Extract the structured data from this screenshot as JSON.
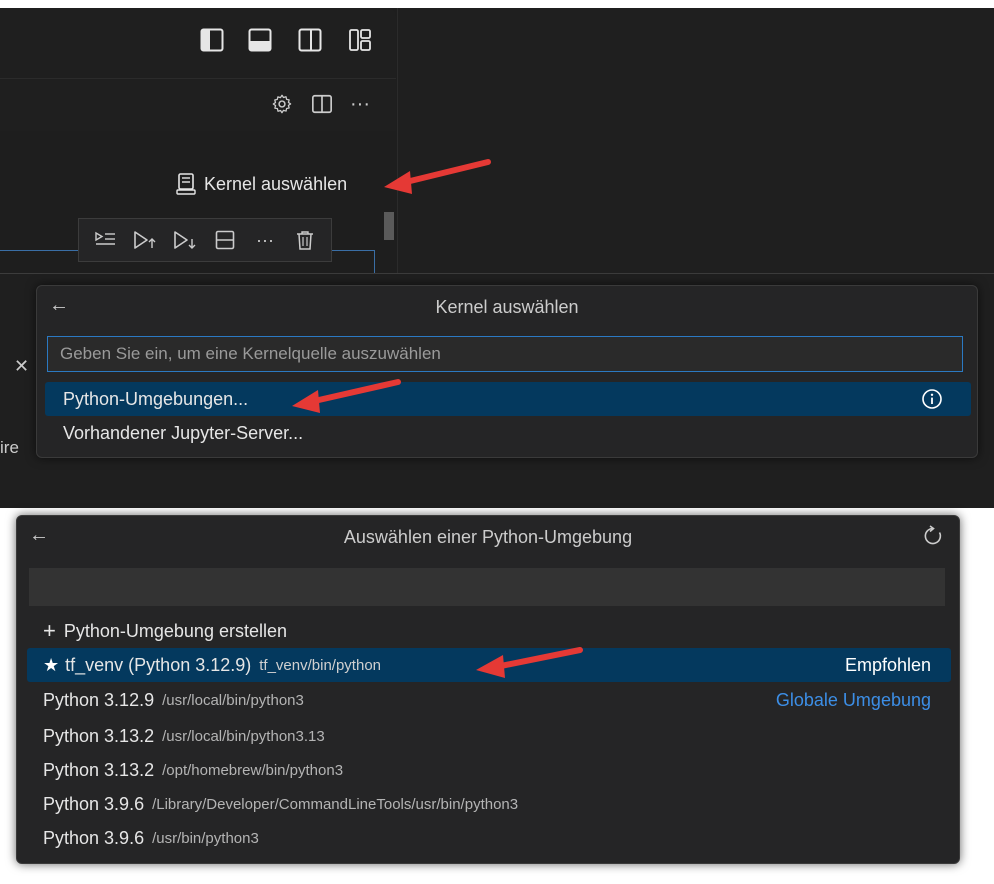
{
  "editor": {
    "kernel_select_label": "Kernel auswählen"
  },
  "icons": {
    "primary_sidebar": "toggle-primary-sidebar-icon",
    "panel": "toggle-panel-icon",
    "secondary_sidebar": "toggle-secondary-sidebar-icon",
    "customize_layout": "customize-layout-icon",
    "settings": "gear-icon",
    "split": "split-editor-icon",
    "more": "ellipsis-icon"
  },
  "middle": {
    "fragment_text": "ire"
  },
  "kernel_picker": {
    "title": "Kernel auswählen",
    "placeholder": "Geben Sie ein, um eine Kernelquelle auszuwählen",
    "items": [
      {
        "label": "Python-Umgebungen..."
      },
      {
        "label": "Vorhandener Jupyter-Server..."
      }
    ]
  },
  "env_picker": {
    "title": "Auswählen einer Python-Umgebung",
    "input_value": "",
    "create_label": "Python-Umgebung erstellen",
    "items": [
      {
        "name": "tf_venv (Python 3.12.9)",
        "path": "tf_venv/bin/python",
        "badge": "Empfohlen"
      },
      {
        "name": "Python 3.12.9",
        "path": "/usr/local/bin/python3",
        "badge": "Globale Umgebung"
      },
      {
        "name": "Python 3.13.2",
        "path": "/usr/local/bin/python3.13"
      },
      {
        "name": "Python 3.13.2",
        "path": "/opt/homebrew/bin/python3"
      },
      {
        "name": "Python 3.9.6",
        "path": "/Library/Developer/CommandLineTools/usr/bin/python3"
      },
      {
        "name": "Python 3.9.6",
        "path": "/usr/bin/python3"
      }
    ]
  },
  "colors": {
    "annotation_arrow": "#e53935",
    "selection": "#04395e",
    "focus_border": "#2b79c2",
    "global_badge": "#3c8ee6"
  }
}
